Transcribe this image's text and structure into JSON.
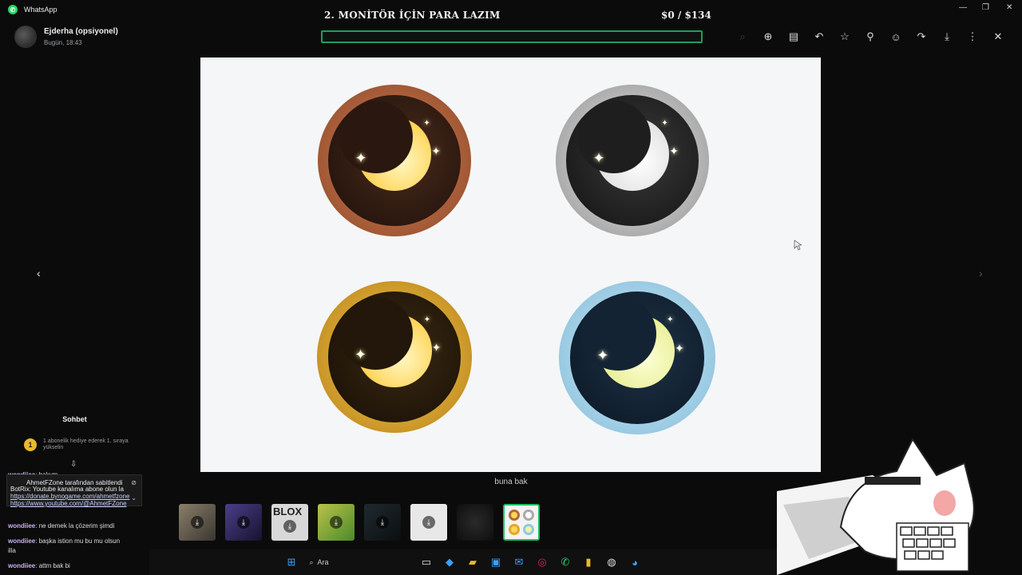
{
  "app": {
    "title": "WhatsApp"
  },
  "donation": {
    "title": "2. MONİTÖR İÇİN PARA LAZIM",
    "amount": "$0 / $134",
    "progress": 0
  },
  "sender": {
    "name": "Ejderha (opsiyonel)",
    "time": "Bugün, 18:43"
  },
  "toolbar": {
    "icons": [
      "search-dim-icon",
      "zoom-in-icon",
      "caption-icon",
      "reply-icon",
      "star-icon",
      "pin-icon",
      "emoji-icon",
      "forward-icon",
      "download-icon",
      "more-icon",
      "close-icon"
    ]
  },
  "caption": "buna bak",
  "thumbnails": {
    "selected_index": 7,
    "label_roblox": "BLOX"
  },
  "chat": {
    "title": "Sohbet",
    "sub_rank": "1",
    "sub_text": "1 abonelik hediye ederek 1. sıraya yükselin",
    "pinned_user": "AhmetFZone",
    "pinned_note": "tarafından sabitlendi",
    "pinned_user2": "BotRix",
    "pinned_msg": "Youtube kanalıma abone olun la",
    "pinned_link": "https://donate.bynogame.com/ahmetfzone",
    "pinned_link2": "https://www.youtube.com/@AhmetFZone",
    "messages": [
      {
        "user": "wondiiee",
        "text": "bakym"
      },
      {
        "user": "wondiiee",
        "text": "ne demek la çözerim şimdi"
      },
      {
        "user": "wondiiee",
        "text": "başka istion mu bu mu olsun"
      },
      {
        "user": "",
        "text": "illa"
      },
      {
        "user": "wondiiee",
        "text": "attm bak bi"
      }
    ]
  },
  "taskbar": {
    "search_label": "Ara"
  },
  "colors": {
    "accent": "#1f9e5f",
    "background": "#0b0b0b",
    "viewer_bg": "#f5f6f7"
  }
}
